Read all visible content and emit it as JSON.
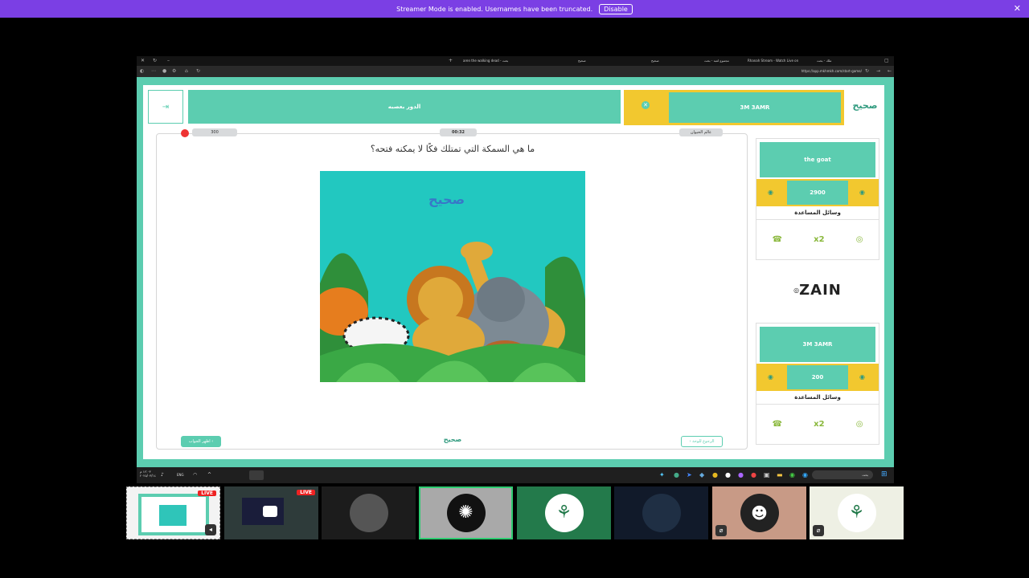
{
  "banner": {
    "text": "Streamer Mode is enabled. Usernames have been truncated.",
    "disable_label": "Disable"
  },
  "browser": {
    "tabs": [
      "aren the walking dead - بحث",
      "صحيح",
      "صحيح",
      "مجموع لعبة - بحث",
      "Rhanah Stream - Watch Live on",
      "ملك - بحث"
    ],
    "url": "https://app.mkhmkh.com/start-game/"
  },
  "game": {
    "team1_name": "3M 3AMR",
    "turn_label": "الدور بعصبه",
    "timer": "00:32",
    "question_points": "300",
    "category": "عالم الحيوان",
    "question": "ما هي السمكة التي تمتلك فكًا لا يمكنه فتحه؟",
    "show_answer_label": "اظهر الجواب",
    "back_label": "الرجوع للوحة",
    "logo_text": "صحيح",
    "sponsor": "ZAIN",
    "teams": [
      {
        "name": "the goat",
        "score": "2900",
        "aids_label": "وسائل المساعدة",
        "aid_x2": "x2"
      },
      {
        "name": "3M 3AMR",
        "score": "200",
        "aids_label": "وسائل المساعدة",
        "aid_x2": "x2"
      }
    ]
  },
  "taskbar": {
    "clock": "١٢:٠٣ م",
    "date": "٢٠٢٥/٠٣/١٤",
    "lang": "ENG",
    "search": "بحث"
  },
  "tiles": {
    "live_label": "LIVE"
  },
  "colors": {
    "teal": "#5ccdb0",
    "yellow": "#f2c82f",
    "banner": "#7b3fe4"
  }
}
